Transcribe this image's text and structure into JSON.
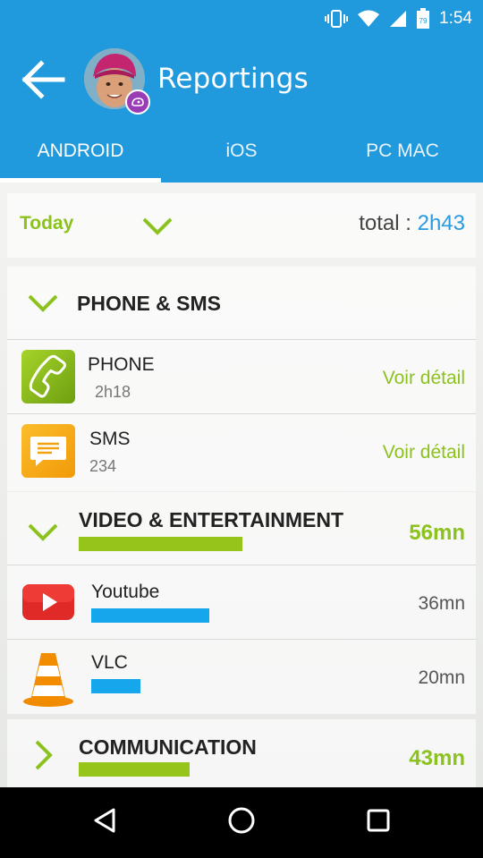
{
  "status_bar": {
    "time": "1:54",
    "battery": "79"
  },
  "app_bar": {
    "title": "Reportings"
  },
  "tabs": [
    {
      "label": "ANDROID",
      "active": true
    },
    {
      "label": "iOS",
      "active": false
    },
    {
      "label": "PC MAC",
      "active": false
    }
  ],
  "period": {
    "label": "Today",
    "total_prefix": "total : ",
    "total_value": "2h43"
  },
  "sections": {
    "phone_sms": {
      "title": "PHONE & SMS",
      "apps": [
        {
          "name": "PHONE",
          "sub": "2h18",
          "action": "Voir détail"
        },
        {
          "name": "SMS",
          "sub": "234",
          "action": "Voir détail"
        }
      ]
    },
    "video": {
      "title": "VIDEO & ENTERTAINMENT",
      "total": "56mn",
      "apps": [
        {
          "name": "Youtube",
          "time": "36mn",
          "share": 0.643
        },
        {
          "name": "VLC",
          "time": "20mn",
          "share": 0.357
        }
      ]
    },
    "communication": {
      "title": "COMMUNICATION",
      "total": "43mn"
    }
  },
  "colors": {
    "primary": "#2199dd",
    "accent_green": "#8cc21e",
    "bar_blue": "#16a6ec"
  },
  "icons": {
    "back": "arrow-left-icon",
    "phone": "phone-app-icon",
    "sms": "sms-app-icon",
    "youtube": "youtube-icon",
    "vlc": "vlc-cone-icon"
  }
}
